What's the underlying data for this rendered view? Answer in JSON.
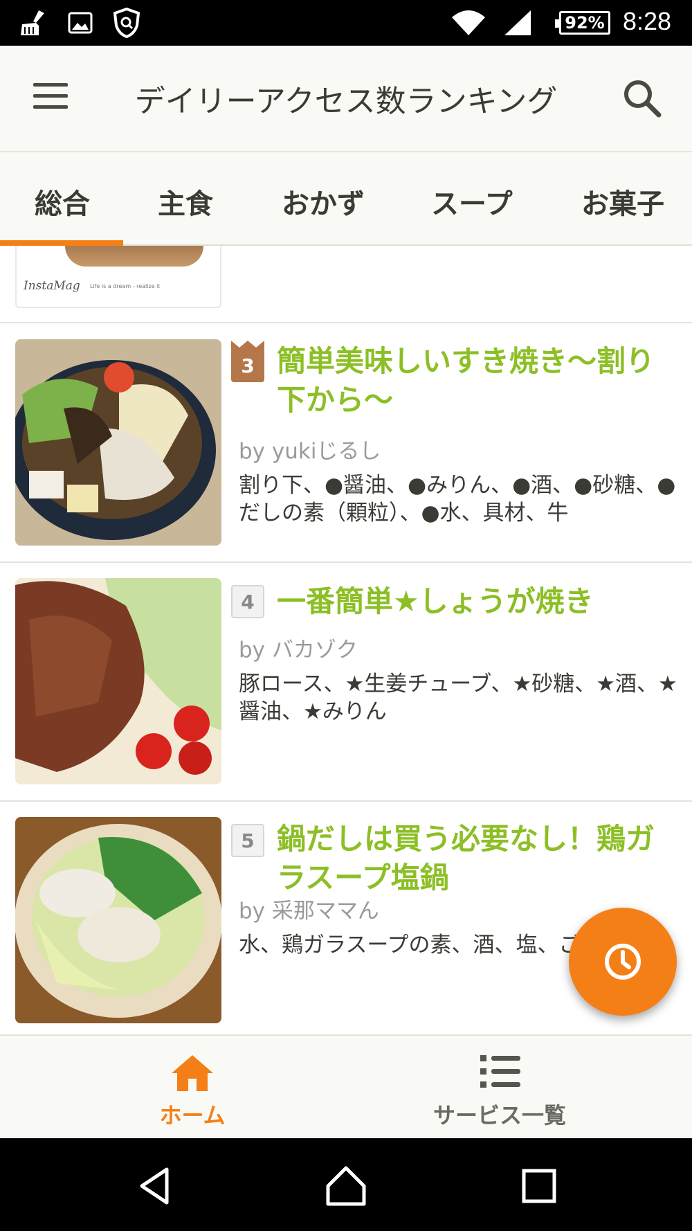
{
  "status_bar": {
    "battery": "92%",
    "time": "8:28",
    "icons": [
      "cleaner-icon",
      "image-icon",
      "shield-icon",
      "wifi-icon",
      "signal-icon",
      "battery-icon"
    ]
  },
  "app_bar": {
    "title": "デイリーアクセス数ランキング",
    "menu_icon": "menu-icon",
    "search_icon": "search-icon"
  },
  "tabs": [
    {
      "label": "総合",
      "selected": true
    },
    {
      "label": "主食",
      "selected": false
    },
    {
      "label": "おかず",
      "selected": false
    },
    {
      "label": "スープ",
      "selected": false
    },
    {
      "label": "お菓子",
      "selected": false
    }
  ],
  "partial_item": {
    "watermark": "InstaMag",
    "watermark_sub": "Life is a dream - realize it"
  },
  "recipes": [
    {
      "rank": "3",
      "title": "簡単美味しいすき焼き〜割り下から〜",
      "author": "by yukiじるし",
      "ingredients": "割り下、●醤油、●みりん、●酒、●砂糖、●だしの素（顆粒）、●水、具材、牛"
    },
    {
      "rank": "4",
      "title": "一番簡単★しょうが焼き",
      "author": "by バカゾク",
      "ingredients": "豚ロース、★生姜チューブ、★砂糖、★酒、★醤油、★みりん"
    },
    {
      "rank": "5",
      "title": "鍋だしは買う必要なし！鶏ガラスープ塩鍋",
      "author": "by 采那ママん",
      "ingredients": "水、鶏ガラスープの素、酒、塩、ごま油"
    }
  ],
  "fab": {
    "icon": "clock-icon"
  },
  "bottom_nav": [
    {
      "label": "ホーム",
      "icon": "home-icon",
      "active": true
    },
    {
      "label": "サービス一覧",
      "icon": "list-icon",
      "active": false
    }
  ],
  "colors": {
    "accent": "#f57f17",
    "title_green": "#8cbf25",
    "bronze": "#b5764a"
  }
}
